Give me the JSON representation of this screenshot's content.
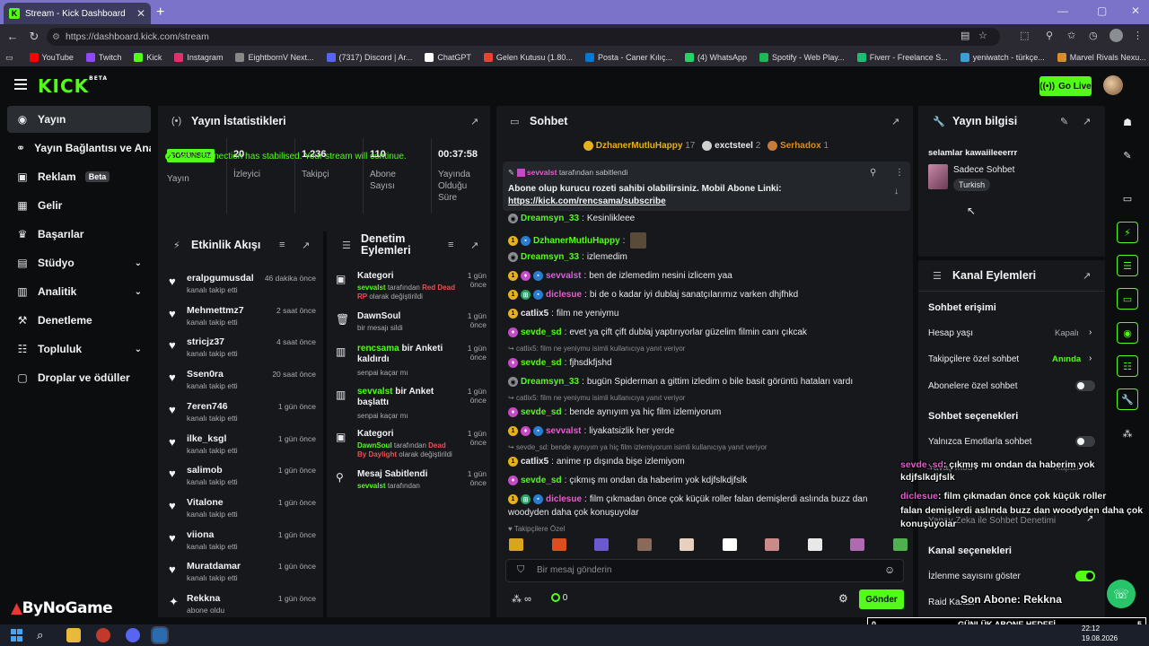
{
  "browser": {
    "tab_title": "Stream - Kick Dashboard",
    "tab_favicon": "K",
    "url": "https://dashboard.kick.com/stream",
    "bookmarks": [
      {
        "label": "YouTube",
        "color": "#ff0000"
      },
      {
        "label": "Twitch",
        "color": "#9146ff"
      },
      {
        "label": "Kick",
        "color": "#53fc18"
      },
      {
        "label": "Instagram",
        "color": "#e1306c"
      },
      {
        "label": "EightbornV Next...",
        "color": "#888888"
      },
      {
        "label": "(7317) Discord | Ar...",
        "color": "#5865f2"
      },
      {
        "label": "ChatGPT",
        "color": "#ffffff"
      },
      {
        "label": "Gelen Kutusu (1.80...",
        "color": "#ea4335"
      },
      {
        "label": "Posta - Caner Kılıç...",
        "color": "#0078d4"
      },
      {
        "label": "(4) WhatsApp",
        "color": "#25d366"
      },
      {
        "label": "Spotify - Web Play...",
        "color": "#1db954"
      },
      {
        "label": "Fiverr - Freelance S...",
        "color": "#1dbf73"
      },
      {
        "label": "yeniwatch - türkçe...",
        "color": "#3aa0d8"
      },
      {
        "label": "Marvel Rivals Nexu...",
        "color": "#d98c2a"
      }
    ]
  },
  "app": {
    "logo": "KICK",
    "logo_sup": "BETA",
    "go_live": "Go Live"
  },
  "sidebar": {
    "items": [
      {
        "label": "Yayın",
        "icon": "broadcast-icon"
      },
      {
        "label": "Yayın Bağlantısı ve Anahtarı",
        "icon": "link-icon"
      },
      {
        "label": "Reklam",
        "icon": "ad-icon",
        "badge": "Beta"
      },
      {
        "label": "Gelir",
        "icon": "wallet-icon"
      },
      {
        "label": "Başarılar",
        "icon": "trophy-icon"
      },
      {
        "label": "Stüdyo",
        "icon": "studio-icon"
      },
      {
        "label": "Analitik",
        "icon": "chart-icon"
      },
      {
        "label": "Denetleme",
        "icon": "hammer-icon"
      },
      {
        "label": "Topluluk",
        "icon": "community-icon"
      },
      {
        "label": "Droplar ve ödüller",
        "icon": "gift-icon"
      }
    ]
  },
  "stats": {
    "title": "Yayın İstatistikleri",
    "status_badge": "SORUNSUZ",
    "status_label": "Yayın",
    "items": [
      {
        "value": "20",
        "label": "İzleyici"
      },
      {
        "value": "1.236",
        "label": "Takipçi"
      },
      {
        "value": "110",
        "label": "Abone Sayısı"
      },
      {
        "value": "00:37:58",
        "label": "Yayında Olduğu Süre"
      }
    ],
    "connection": "Your connection has stabilised. Your stream will continue."
  },
  "activity": {
    "title": "Etkinlik Akışı",
    "items": [
      {
        "name": "eralpgumusdal",
        "sub": "kanalı takip etti",
        "time": "46 dakika önce"
      },
      {
        "name": "Mehmettmz7",
        "sub": "kanalı takip etti",
        "time": "2 saat önce"
      },
      {
        "name": "stricjz37",
        "sub": "kanalı takip etti",
        "time": "4 saat önce"
      },
      {
        "name": "Ssen0ra",
        "sub": "kanalı takip etti",
        "time": "20 saat önce"
      },
      {
        "name": "7eren746",
        "sub": "kanalı takip etti",
        "time": "1 gün önce"
      },
      {
        "name": "ilke_ksgl",
        "sub": "kanalı takip etti",
        "time": "1 gün önce"
      },
      {
        "name": "salimob",
        "sub": "kanalı takip etti",
        "time": "1 gün önce"
      },
      {
        "name": "Vitalone",
        "sub": "kanalı takip etti",
        "time": "1 gün önce"
      },
      {
        "name": "viiona",
        "sub": "kanalı takip etti",
        "time": "1 gün önce"
      },
      {
        "name": "Muratdamar",
        "sub": "kanalı takip etti",
        "time": "1 gün önce"
      },
      {
        "name": "Rekkna",
        "sub": "abone oldu",
        "time": "1 gün önce"
      }
    ]
  },
  "moderation": {
    "title": "Denetim Eylemleri",
    "items": [
      {
        "title": "Kategori",
        "time": "1 gün önce",
        "actor": "sevvalst",
        "mid": " tarafından ",
        "target": "Red Dead RP",
        "tail": " olarak değiştirildi"
      },
      {
        "title": "DawnSoul",
        "time": "1 gün önce",
        "sub": "bir mesajı sildi"
      },
      {
        "actor": "rencsama",
        "title2": " bir Anketi kaldırdı",
        "time": "1 gün önce",
        "sub": "senpai kaçar mı"
      },
      {
        "actor": "sevvalst",
        "title2": " bir Anket başlattı",
        "time": "1 gün önce",
        "sub": "senpai kaçar mı"
      },
      {
        "title": "Kategori",
        "time": "1 gün önce",
        "actor": "DawnSoul",
        "mid": " tarafından ",
        "target": "Dead By Daylight",
        "tail": " olarak değiştirildi"
      },
      {
        "title": "Mesaj Sabitlendi",
        "time": "1 gün önce",
        "actor": "sevvalst",
        "mid": " tarafından"
      }
    ]
  },
  "chat": {
    "title": "Sohbet",
    "top_gifters": [
      {
        "name": "DzhanerMutluHappy",
        "count": "17"
      },
      {
        "name": "exctsteel",
        "count": "2"
      },
      {
        "name": "Serhadox",
        "count": "1"
      }
    ],
    "pinned": {
      "by": "sevvalst",
      "by_suffix": "tarafından sabitlendi",
      "text": "Abone olup kurucu rozeti sahibi olabilirsiniz. Mobil Abone Linki:",
      "link": "https://kick.com/rencsama/subscribe"
    },
    "messages": [
      {
        "user": "Dreamsyn_33",
        "text": "Kesinlikleee",
        "color": "#53fc18"
      },
      {
        "user": "DzhanerMutluHappy",
        "text": "",
        "color": "#53fc18"
      },
      {
        "user": "Dreamsyn_33",
        "text": "izlemedim",
        "color": "#53fc18"
      },
      {
        "user": "sevvalst",
        "text": "ben de izlemedim nesini izlicem yaa",
        "color": "#e85bd1"
      },
      {
        "user": "diclesue",
        "text": "bi de o kadar iyi dublaj sanatçılarımız varken dhjfhkd",
        "color": "#e85bd1"
      },
      {
        "user": "catlix5",
        "text": "film ne yeniymu",
        "color": "#e8eaed"
      },
      {
        "user": "sevde_sd",
        "text": "evet ya çift çift dublaj yaptırıyorlar güzelim filmin canı çıkcak",
        "color": "#53fc18"
      },
      {
        "reply": "catlix5: film ne yeniymu isimli kullanıcıya yanıt veriyor"
      },
      {
        "user": "sevde_sd",
        "text": "fjhsdkfjshd",
        "color": "#53fc18"
      },
      {
        "user": "Dreamsyn_33",
        "text": "bugün Spiderman a gittim izledim o bile basit görüntü hataları vardı",
        "color": "#53fc18"
      },
      {
        "reply": "catlix5: film ne yeniymu isimli kullanıcıya yanıt veriyor"
      },
      {
        "user": "sevde_sd",
        "text": "bende aynıyım ya hiç film izlemiyorum",
        "color": "#53fc18"
      },
      {
        "user": "sevvalst",
        "text": "liyakatsizlik her yerde",
        "color": "#e85bd1"
      },
      {
        "reply": "sevde_sd: bende aynıyım ya hiç film izlemiyorum isimli kullanıcıya yanıt veriyor"
      },
      {
        "user": "catlix5",
        "text": "anime rp dışında bişe izlemiyom",
        "color": "#e8eaed"
      },
      {
        "user": "sevde_sd",
        "text": "çıkmış mı ondan da haberim yok kdjfslkdjfslk",
        "color": "#53fc18"
      },
      {
        "user": "diclesue",
        "text": "film çıkmadan önce çok küçük roller falan demişlerdi aslında buzz dan",
        "text2": "woodyden daha çok konuşuyolar",
        "color": "#e85bd1"
      }
    ],
    "emote_section": "Takipçilere Özel",
    "input_placeholder": "Bir mesaj gönderin",
    "infinity": "∞",
    "points": "0",
    "send": "Gönder"
  },
  "stream_info": {
    "title": "Yayın bilgisi",
    "stream_title": "selamlar kawaiileeerrr",
    "category": "Sadece Sohbet",
    "language": "Turkish"
  },
  "channel_actions": {
    "title": "Kanal Eylemleri",
    "chat_access": "Sohbet erişimi",
    "rows": [
      {
        "label": "Hesap yaşı",
        "value": "Kapalı"
      },
      {
        "label": "Takipçilere özel sohbet",
        "value": "Anında"
      },
      {
        "label": "Abonelere özel sohbet",
        "toggle": false
      }
    ],
    "chat_options": "Sohbet seçenekleri",
    "emote_only": "Yalnızca Emotlarla sohbet",
    "slow_mode": "Yavaş mod",
    "slow_value": "Kapalı",
    "ai_mod": "Yapay Zeka ile Sohbet Denetimi",
    "channel_options": "Kanal seçenekleri",
    "show_views": "İzlenme sayısını göster",
    "raid": "Raid Kanalı"
  },
  "overlay": {
    "chat1_user": "sevde_sd",
    "chat1_text": ": çıkmış mı ondan da haberim yok",
    "chat1_text2": "kdjfslkdjfslk",
    "chat2_user": "diclesue",
    "chat2_text": ": film çıkmadan önce çok küçük roller",
    "chat2_text2": "falan demişlerdi aslında buzz dan woodyden daha çok",
    "chat2_text3": "konuşuyolar",
    "last_sub": "Son Abone: Rekkna",
    "goal_left": "0",
    "goal_title": "GÜNLÜK ABONE HEDEFİ",
    "goal_right": "5",
    "brand": "ByNoGame"
  },
  "taskbar": {
    "time": "22:12",
    "date": "19.08.2026"
  }
}
